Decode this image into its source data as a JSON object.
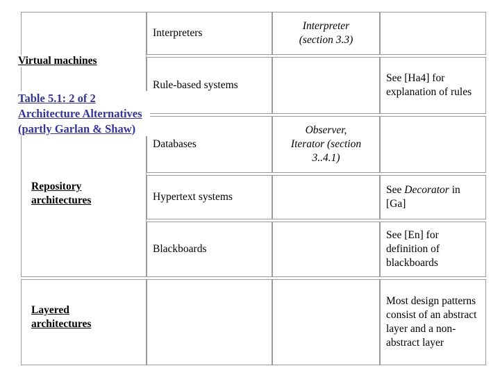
{
  "slide": {
    "title_link": "Table 5.1: 2 of 2 Architecture Alternatives (partly Garlan & Shaw)",
    "title_color": "#333399",
    "border_color": "#9a9a9a",
    "background": "#ffffff"
  },
  "categories": {
    "virtual_machines": "Virtual machines",
    "repository_line1": "Repository",
    "repository_line2": "architectures",
    "layered_line1": "Layered",
    "layered_line2": "architectures"
  },
  "table": {
    "rows": [
      {
        "category": "",
        "style": "Interpreters",
        "pattern": "Interpreter (section 3.3)",
        "pattern_line1": "Interpreter",
        "pattern_line2": "(section 3.3)",
        "remark": ""
      },
      {
        "category": "",
        "style": "Rule-based systems",
        "pattern": "",
        "remark": "See [Ha4] for explanation of rules"
      },
      {
        "category": "",
        "style": "Databases",
        "pattern": "Observer, Iterator (section 3..4.1)",
        "pattern_line1": "Observer,",
        "pattern_line2": "Iterator (section",
        "pattern_line3": "3..4.1)",
        "remark": ""
      },
      {
        "category": "",
        "style": "Hypertext systems",
        "pattern": "",
        "remark_prefix": "See ",
        "remark_italic": "Decorator",
        "remark_suffix": " in [Ga]"
      },
      {
        "category": "",
        "style": "Blackboards",
        "pattern": "",
        "remark": "See [En] for definition of blackboards"
      },
      {
        "category": "",
        "style": "",
        "pattern": "",
        "remark": "Most design patterns consist of an abstract layer and a non-abstract layer"
      }
    ]
  }
}
